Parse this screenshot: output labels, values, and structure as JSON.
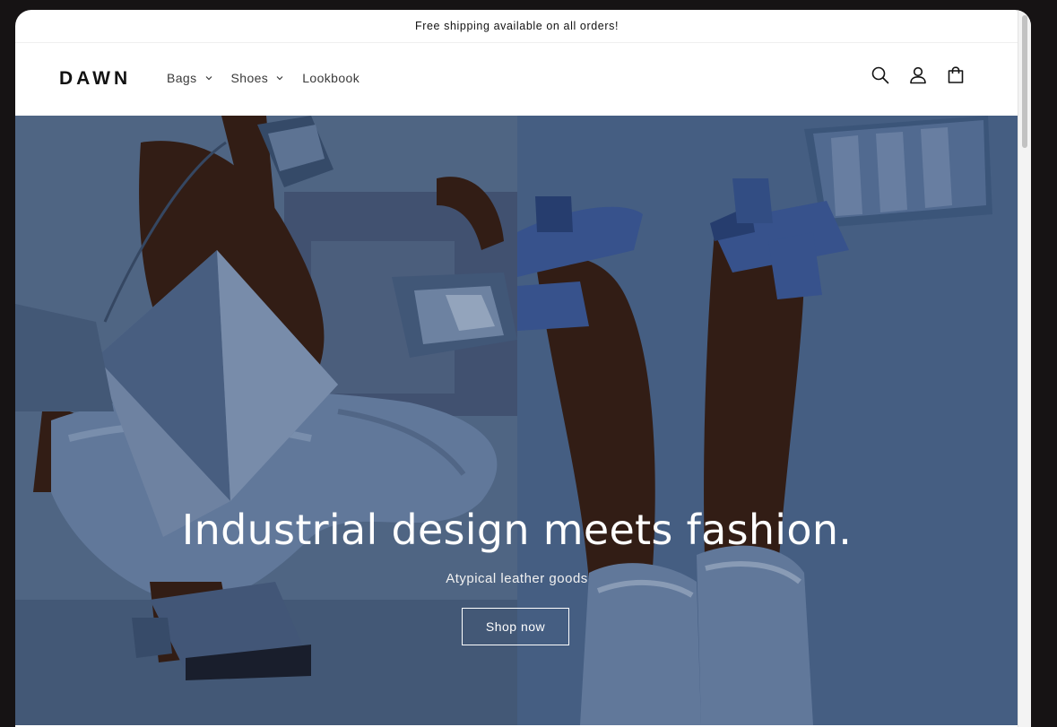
{
  "announcement": {
    "text": "Free shipping available on all orders!"
  },
  "header": {
    "logo": "DAWN",
    "nav": [
      {
        "label": "Bags",
        "has_dropdown": true
      },
      {
        "label": "Shoes",
        "has_dropdown": true
      },
      {
        "label": "Lookbook",
        "has_dropdown": false
      }
    ],
    "icons": [
      "search-icon",
      "account-icon",
      "cart-icon"
    ]
  },
  "hero": {
    "title": "Industrial design meets fashion.",
    "subtitle": "Atypical leather goods",
    "button_label": "Shop now"
  },
  "colors": {
    "text": "#121212",
    "hero_blue": "#4f6b94",
    "denim": "#6f89b0",
    "skin": "#3a2219",
    "white": "#ffffff"
  }
}
